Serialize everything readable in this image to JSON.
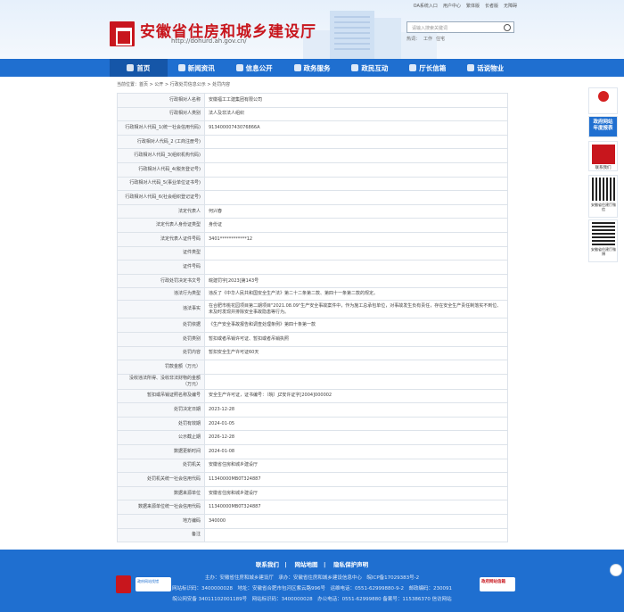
{
  "header": {
    "top_links": [
      "OA系统入口",
      "用户中心",
      "繁体版",
      "长者版",
      "无障碍"
    ],
    "title": "安徽省住房和城乡建设厅",
    "url": "http://dohurd.ah.gov.cn/",
    "search_placeholder": "请输入搜索关键词",
    "hotwords": [
      "热词：",
      "工作",
      "住宅"
    ]
  },
  "nav": [
    "首页",
    "新闻资讯",
    "信息公开",
    "政务服务",
    "政民互动",
    "厅长信箱",
    "话说物业"
  ],
  "breadcrumb": "当前位置：首页 > 公开 > 行政处罚信息公示 > 处罚内容",
  "rows": [
    {
      "k": "行政相对人名称",
      "v": "安徽福工工建集团有限公司"
    },
    {
      "k": "行政相对人类别",
      "v": "法人及非法人组织"
    },
    {
      "k": "行政相对人代码_1(统一社会信用代码)",
      "v": "91340000743076866A"
    },
    {
      "k": "行政相对人代码_2 (工商注册号)",
      "v": ""
    },
    {
      "k": "行政相对人代码_3(组织机构代码)",
      "v": ""
    },
    {
      "k": "行政相对人代码_4(税务登记号)",
      "v": ""
    },
    {
      "k": "行政相对人代码_5(事业单位证书号)",
      "v": ""
    },
    {
      "k": "行政相对人代码_6(社会组织登记证号)",
      "v": ""
    },
    {
      "k": "法定代表人",
      "v": "何兴春"
    },
    {
      "k": "法定代表人身份证类型",
      "v": "身份证"
    },
    {
      "k": "法定代表人证件号码",
      "v": "3401************12"
    },
    {
      "k": "证件类型",
      "v": ""
    },
    {
      "k": "证件号码",
      "v": ""
    },
    {
      "k": "行政处罚决定书文号",
      "v": "皖建罚字[2023]第143号"
    },
    {
      "k": "违法行为类型",
      "v": "违反了《中华人民共和国安全生产法》第二十二条第二款、第四十一条第二款的规定。"
    },
    {
      "k": "违法事实",
      "v": "在合肥市桃花园项目第二期项目\"2021.08.09\"生产安全事故案件中，作为施工总承包单位，对事故发生负有责任，存在安全生产责任制落实不到位、未及时发现并排除安全事故隐患等行为。"
    },
    {
      "k": "处罚依据",
      "v": "《生产安全事故报告和调查处理条例》第四十条第一款"
    },
    {
      "k": "处罚类别",
      "v": "暂扣或者吊销许可证、暂扣或者吊销执照"
    },
    {
      "k": "处罚内容",
      "v": "暂扣安全生产许可证60天"
    },
    {
      "k": "罚款金额（万元）",
      "v": ""
    },
    {
      "k": "没收违法所得、没收非法财物的金额（万元）",
      "v": ""
    },
    {
      "k": "暂扣或吊销证照名称及编号",
      "v": "安全生产许可证，证书编号：（皖）JZ安许证字[2004]000002"
    },
    {
      "k": "处罚决定日期",
      "v": "2023-12-28"
    },
    {
      "k": "处罚有效期",
      "v": "2024-01-05"
    },
    {
      "k": "公示截止期",
      "v": "2026-12-28"
    },
    {
      "k": "数据更新时间",
      "v": "2024-01-08"
    },
    {
      "k": "处罚机关",
      "v": "安徽省住房和城乡建设厅"
    },
    {
      "k": "处罚机关统一社会信用代码",
      "v": "11340000MB0T324887"
    },
    {
      "k": "数据来源单位",
      "v": "安徽省住房和城乡建设厅"
    },
    {
      "k": "数据来源单位统一社会信用代码",
      "v": "11340000MB0T324887"
    },
    {
      "k": "地方编码",
      "v": "340000"
    },
    {
      "k": "备注",
      "v": ""
    }
  ],
  "side": {
    "gov_report": "政府网站年度报表",
    "contact": "联系我们",
    "qr1": "安徽省住建厅微信",
    "qr2": "安徽省住建厅微博"
  },
  "footer": {
    "links": [
      "联系我们",
      "网站地图",
      "隐私保护声明"
    ],
    "line1": "主办：安徽省住房和城乡建设厅　承办：安徽省住房和城乡建设信息中心　皖ICP备17029383号-2",
    "line2": "网站标识码：3400000028　地址：安徽省合肥市包河区紫云路996号　运维电话：0551-62999880-9-2　邮政编码：230091",
    "line3": "皖公网安备 34011102001189号　网站标识码：3400000028　办公电话：0551-62999880 备案号：115386370 信访网站",
    "badge_left": "政府网站找错",
    "badge_right": "政府网站信箱"
  }
}
